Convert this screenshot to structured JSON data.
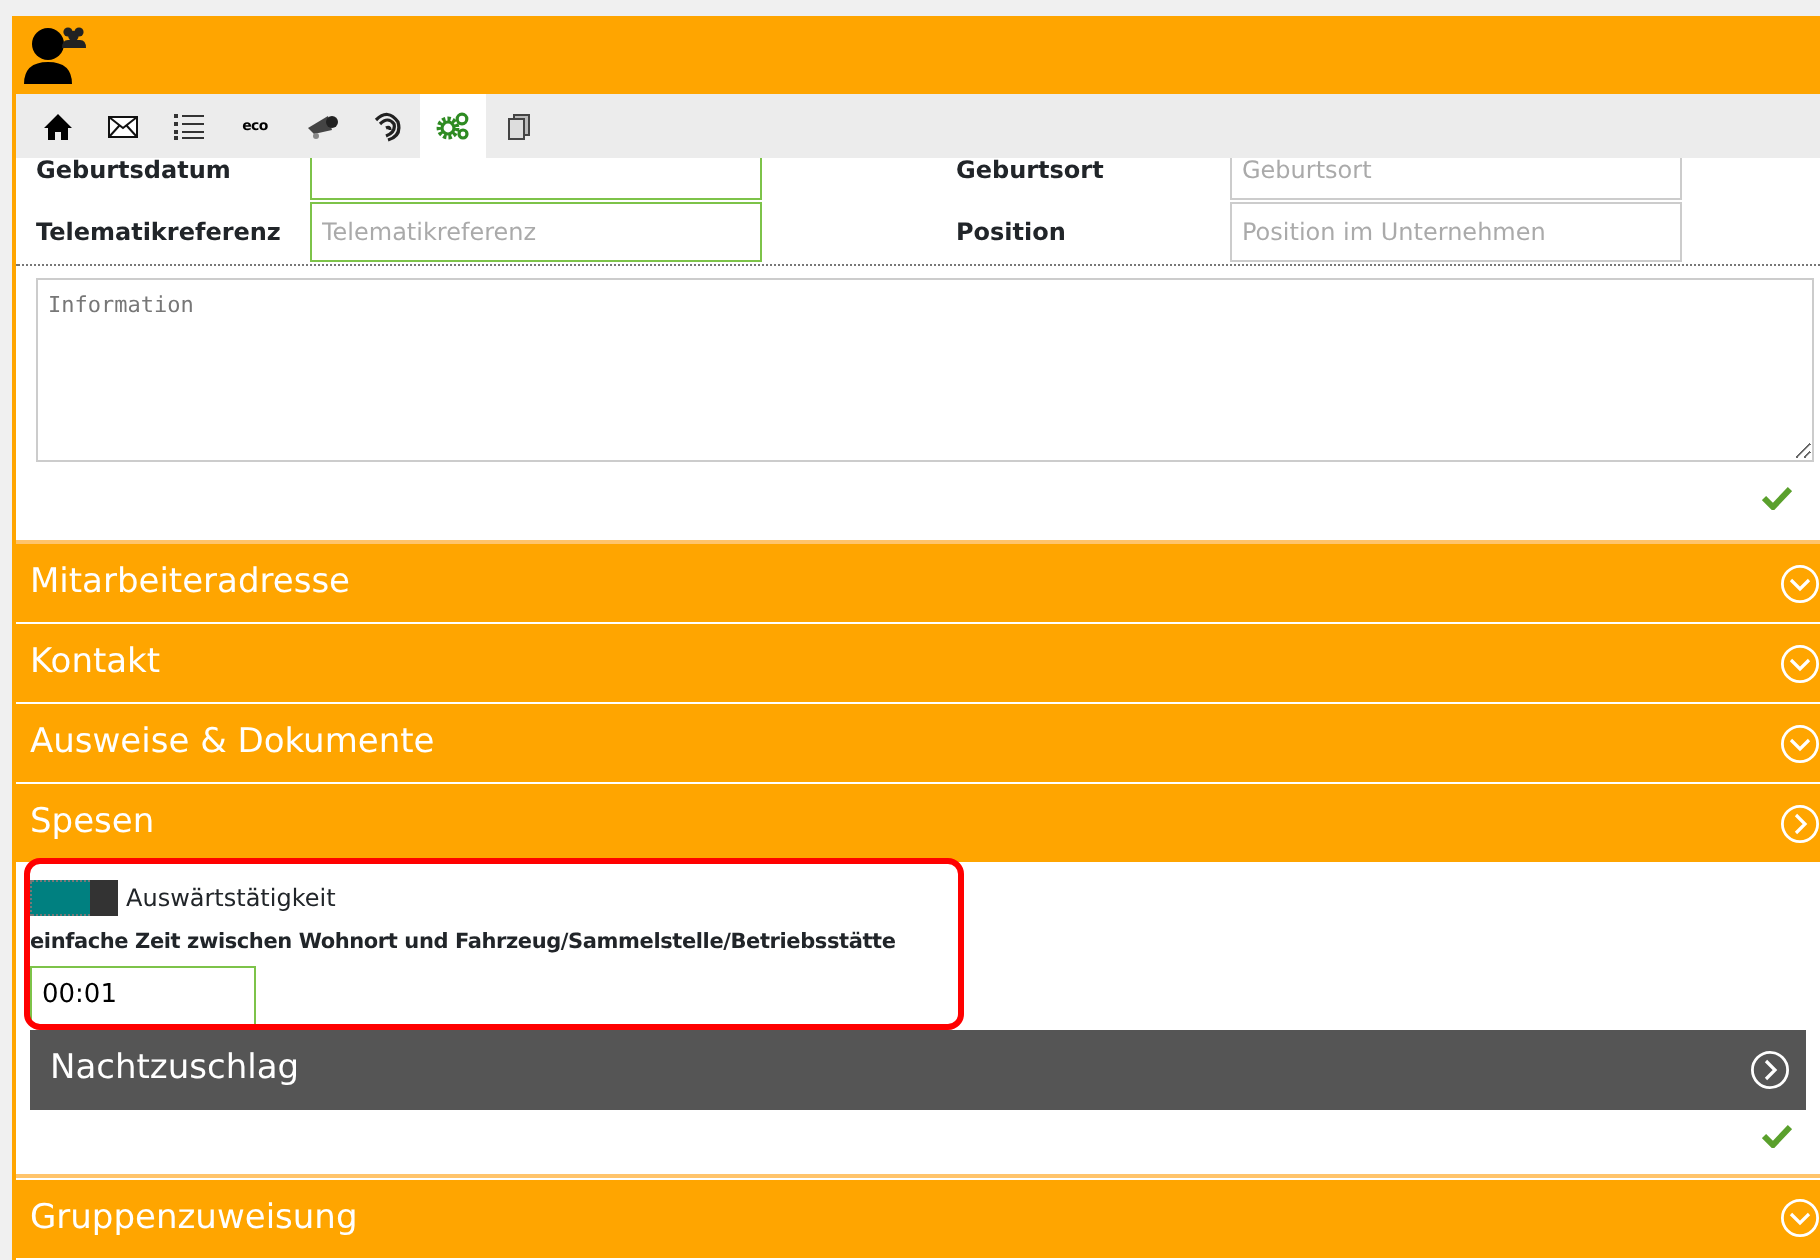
{
  "toolbar": [
    {
      "kind": "home",
      "selected": false
    },
    {
      "kind": "mail",
      "selected": false
    },
    {
      "kind": "list",
      "selected": false
    },
    {
      "kind": "text",
      "label": "eco",
      "selected": false
    },
    {
      "kind": "tools",
      "selected": false
    },
    {
      "kind": "spiral",
      "selected": false
    },
    {
      "kind": "gears",
      "selected": true
    },
    {
      "kind": "docs",
      "selected": false
    }
  ],
  "form": {
    "rows": [
      {
        "left": {
          "label": "Geburtsdatum"
        },
        "right": {
          "label": "Geburtsort",
          "placeholder": "Geburtsort"
        }
      },
      {
        "left": {
          "label": "Telematikreferenz",
          "placeholder": "Telematikreferenz"
        },
        "right": {
          "label": "Position",
          "placeholder": "Position im Unternehmen"
        }
      }
    ],
    "info_placeholder": "Information"
  },
  "sections": [
    {
      "title": "Mitarbeiteradresse",
      "expanded": false
    },
    {
      "title": "Kontakt",
      "expanded": false
    },
    {
      "title": "Ausweise & Dokumente",
      "expanded": false
    },
    {
      "title": "Spesen",
      "expanded": true,
      "toggle": {
        "label": "Auswärtstätigkeit",
        "on": true
      },
      "field": {
        "label": "einfache Zeit zwischen Wohnort und Fahrzeug/Sammelstelle/Betriebsstätte",
        "value": "00:01"
      },
      "subsections": [
        {
          "title": "Nachtzuschlag",
          "expanded": false
        }
      ]
    },
    {
      "title": "Gruppenzuweisung",
      "expanded": false
    }
  ]
}
